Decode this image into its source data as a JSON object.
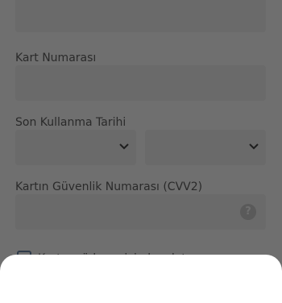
{
  "form": {
    "card_number_label": "Kart Numarası",
    "expiry_label": "Son Kullanma Tarihi",
    "cvv_label": "Kartın Güvenlik Numarası (CVV2)",
    "cvv_help_glyph": "?",
    "save_card_text": "Kartımı ödeme için kaydet"
  }
}
